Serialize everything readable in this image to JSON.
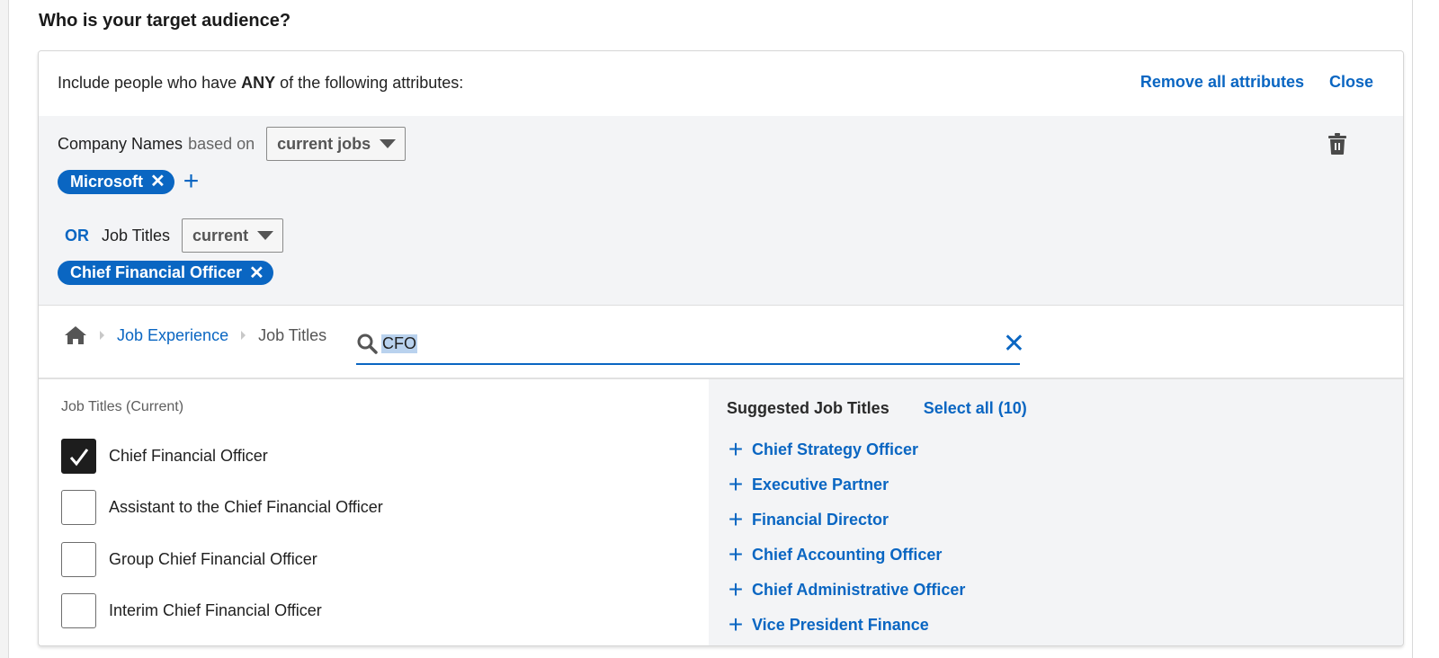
{
  "heading": "Who is your target audience?",
  "panel": {
    "include_prefix": "Include people who have ",
    "include_emphasis": "ANY",
    "include_suffix": " of the following attributes:",
    "remove_all_label": "Remove all attributes",
    "close_label": "Close"
  },
  "attributes": {
    "company": {
      "label": "Company Names",
      "qualifier": "based on",
      "select_value": "current jobs",
      "pills": [
        "Microsoft"
      ],
      "add_icon": "plus-icon"
    },
    "job_titles": {
      "connector": "OR",
      "label": "Job Titles",
      "select_value": "current",
      "pills": [
        "Chief Financial Officer"
      ]
    },
    "delete_icon": "trash-icon"
  },
  "search": {
    "breadcrumb": {
      "home_icon": "home-icon",
      "items": [
        "Job Experience",
        "Job Titles"
      ]
    },
    "query": "CFO",
    "clear_icon": "close-icon"
  },
  "results": {
    "section_label": "Job Titles (Current)",
    "options": [
      {
        "label": "Chief Financial Officer",
        "checked": true
      },
      {
        "label": "Assistant to the Chief Financial Officer",
        "checked": false
      },
      {
        "label": "Group Chief Financial Officer",
        "checked": false
      },
      {
        "label": "Interim Chief Financial Officer",
        "checked": false
      }
    ]
  },
  "suggestions": {
    "title": "Suggested Job Titles",
    "select_all_label": "Select all (10)",
    "items": [
      "Chief Strategy Officer",
      "Executive Partner",
      "Financial Director",
      "Chief Accounting Officer",
      "Chief Administrative Officer",
      "Vice President Finance"
    ]
  },
  "colors": {
    "accent": "#0a66c2",
    "panel_bg": "#f3f4f6",
    "checkbox_checked": "#1d1d1d"
  }
}
